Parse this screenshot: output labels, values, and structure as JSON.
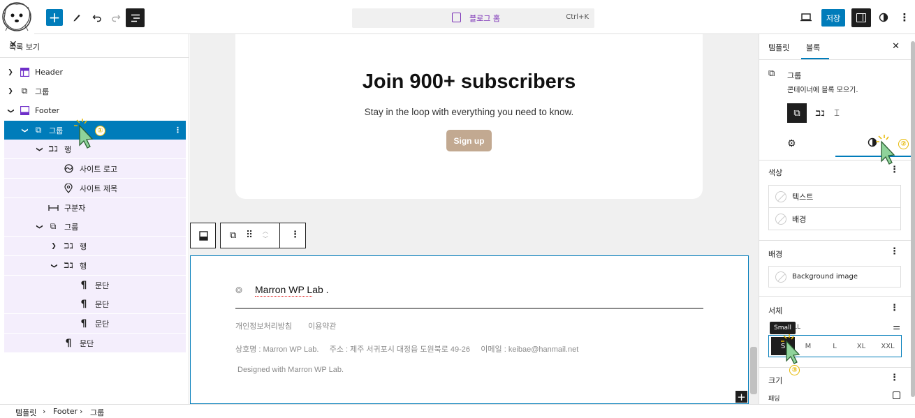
{
  "topbar": {
    "command_title": "블로그 홈",
    "command_shortcut": "Ctrl+K",
    "save_label": "저장"
  },
  "list_view": {
    "title": "목록 보기",
    "items": [
      {
        "label": "Header"
      },
      {
        "label": "그룹"
      },
      {
        "label": "Footer"
      },
      {
        "label": "그룹"
      },
      {
        "label": "행"
      },
      {
        "label": "사이트 로고"
      },
      {
        "label": "사이트 제목"
      },
      {
        "label": "구분자"
      },
      {
        "label": "그룹"
      },
      {
        "label": "행"
      },
      {
        "label": "행"
      },
      {
        "label": "문단"
      },
      {
        "label": "문단"
      },
      {
        "label": "문단"
      },
      {
        "label": "문단"
      }
    ]
  },
  "canvas": {
    "heading": "Join 900+ subscribers",
    "subheading": "Stay in the loop with everything you need to know.",
    "signup": "Sign up",
    "footer": {
      "site_title": "Marron WP Lab .",
      "link1": "개인정보처리방침",
      "link2": "이용약관",
      "info": "상호명 : Marron WP Lab.     주소 : 제주 서귀포시 대정읍 도원북로 49-26     이메일 : keibae@hanmail.net",
      "credit": "Designed with Marron WP Lab."
    }
  },
  "sidebar": {
    "tab_template": "템플릿",
    "tab_block": "블록",
    "block_name": "그룹",
    "block_desc": "콘테이너에 블록 모으기.",
    "color_title": "색상",
    "color_text": "텍스트",
    "color_bg": "배경",
    "bg_title": "배경",
    "bg_image": "Background image",
    "typo_title": "서체",
    "font_size_label": "LL",
    "sizes": [
      "S",
      "M",
      "L",
      "XL",
      "XXL"
    ],
    "tooltip": "Small",
    "size_title": "크기",
    "padding_label": "패딩"
  },
  "breadcrumb": [
    "템플릿",
    "Footer",
    "그룹"
  ],
  "annotations": [
    "①",
    "②",
    "③"
  ],
  "colors": {
    "accent": "#007cba",
    "selection_bg": "#f4eefc",
    "button": "#c2a991"
  }
}
